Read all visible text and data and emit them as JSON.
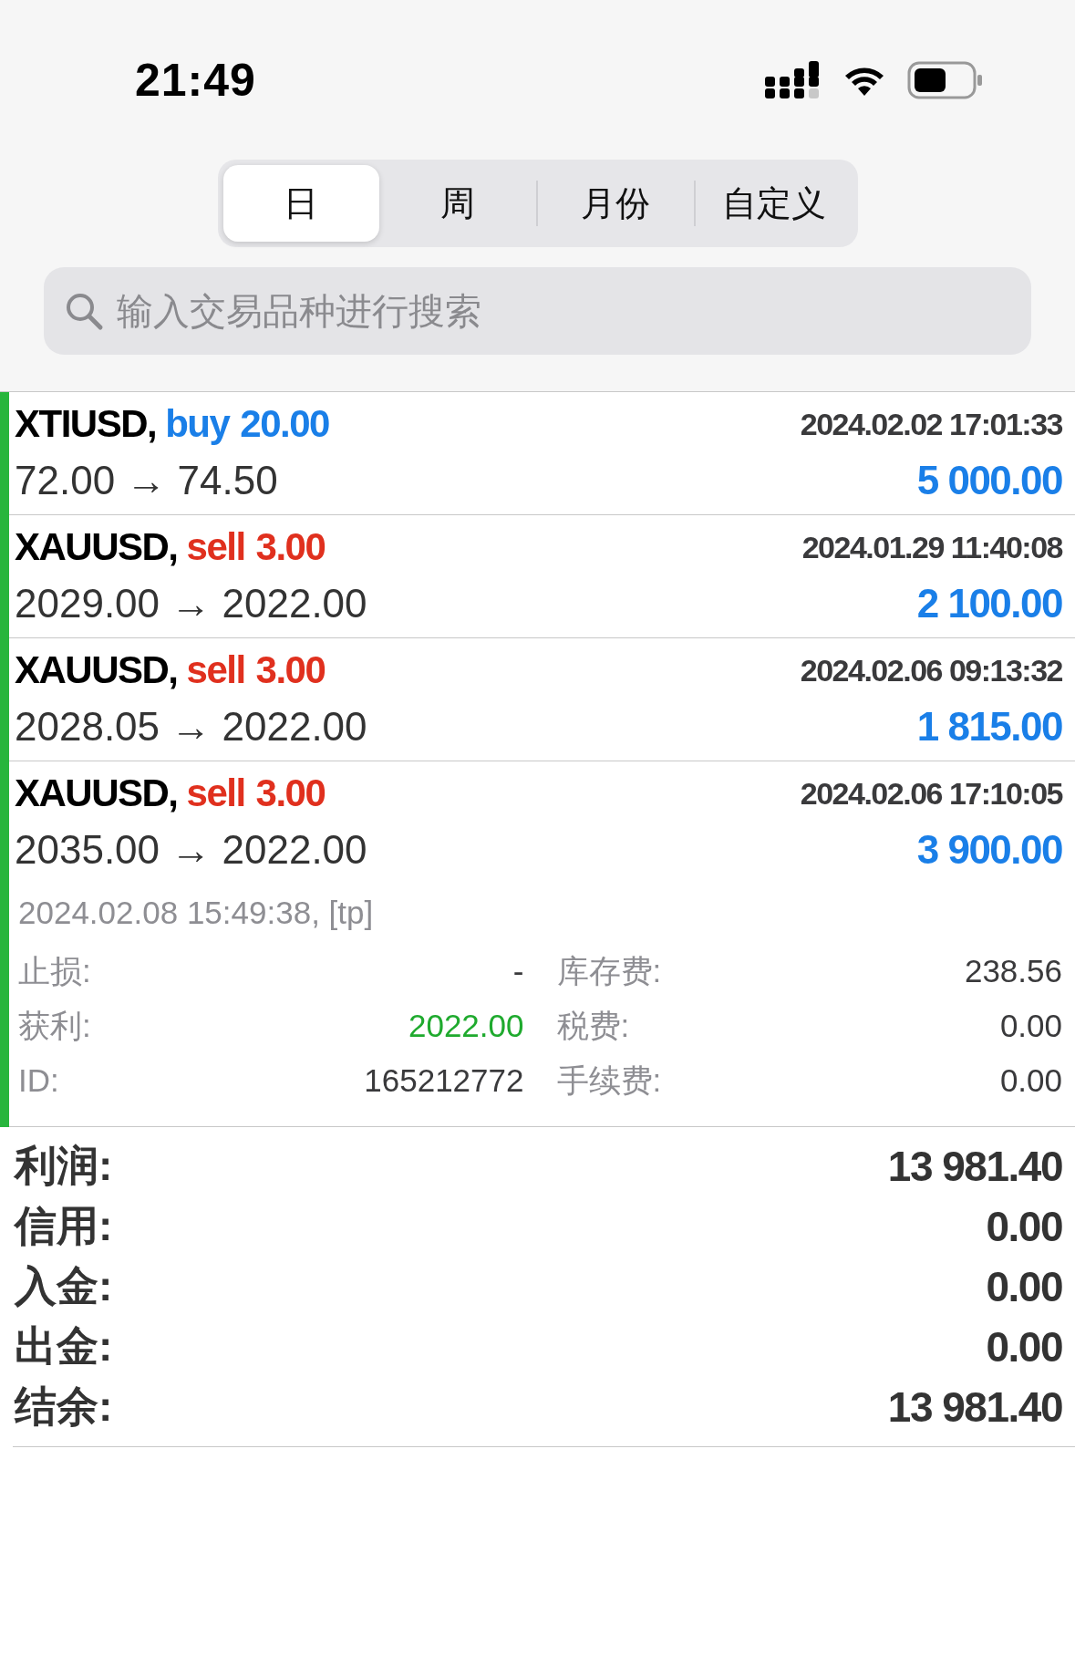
{
  "status_bar": {
    "time": "21:49"
  },
  "tabs": [
    {
      "label": "日",
      "selected": true
    },
    {
      "label": "周",
      "selected": false
    },
    {
      "label": "月份",
      "selected": false
    },
    {
      "label": "自定义",
      "selected": false
    }
  ],
  "search": {
    "placeholder": "输入交易品种进行搜索"
  },
  "trades": [
    {
      "symbol": "XTIUSD,",
      "side": "buy",
      "kind": "buy",
      "volume": "20.00",
      "open_time": "2024.02.02 17:01:33",
      "prices": "72.00 → 74.50",
      "profit": "5 000.00",
      "expanded": false
    },
    {
      "symbol": "XAUUSD,",
      "side": "sell",
      "kind": "sell",
      "volume": "3.00",
      "open_time": "2024.01.29 11:40:08",
      "prices": "2029.00 → 2022.00",
      "profit": "2 100.00",
      "expanded": false
    },
    {
      "symbol": "XAUUSD,",
      "side": "sell",
      "kind": "sell",
      "volume": "3.00",
      "open_time": "2024.02.06 09:13:32",
      "prices": "2028.05 → 2022.00",
      "profit": "1 815.00",
      "expanded": false
    },
    {
      "symbol": "XAUUSD,",
      "side": "sell",
      "kind": "sell",
      "volume": "3.00",
      "open_time": "2024.02.06 17:10:05",
      "prices": "2035.00 → 2022.00",
      "profit": "3 900.00",
      "expanded": true,
      "close_info": "2024.02.08 15:49:38, [tp]",
      "details": [
        {
          "label": "止损:",
          "value": "-",
          "kind": "plain"
        },
        {
          "label": "获利:",
          "value": "2022.00",
          "kind": "take-profit"
        },
        {
          "label": "ID:",
          "value": "165212772",
          "kind": "plain"
        },
        {
          "label": "库存费:",
          "value": "238.56",
          "kind": "plain"
        },
        {
          "label": "税费:",
          "value": "0.00",
          "kind": "plain"
        },
        {
          "label": "手续费:",
          "value": "0.00",
          "kind": "plain"
        }
      ]
    }
  ],
  "summary": [
    {
      "label": "利润:",
      "value": "13 981.40"
    },
    {
      "label": "信用:",
      "value": "0.00"
    },
    {
      "label": "入金:",
      "value": "0.00"
    },
    {
      "label": "出金:",
      "value": "0.00"
    },
    {
      "label": "结余:",
      "value": "13 981.40"
    }
  ]
}
